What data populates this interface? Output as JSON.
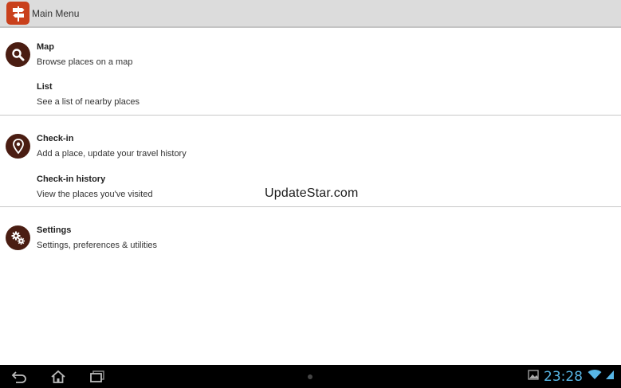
{
  "action_bar": {
    "title": "Main Menu",
    "app_icon": "signpost-icon"
  },
  "menu": [
    {
      "icon": "search-icon",
      "title": "Map",
      "subtitle": "Browse places on a map"
    },
    {
      "icon": null,
      "title": "List",
      "subtitle": "See a list of nearby places"
    },
    {
      "icon": "map-pin-icon",
      "title": "Check-in",
      "subtitle": "Add a place, update your travel history"
    },
    {
      "icon": null,
      "title": "Check-in history",
      "subtitle": "View the places you've visited"
    },
    {
      "icon": "gears-icon",
      "title": "Settings",
      "subtitle": "Settings, preferences & utilities"
    }
  ],
  "watermark": "UpdateStar.com",
  "system_bar": {
    "clock": "23:28",
    "buttons": [
      "back-icon",
      "home-icon",
      "recent-apps-icon"
    ],
    "status_icons": [
      "gallery-icon",
      "wifi-icon",
      "signal-icon"
    ],
    "clock_color": "#58b7e6"
  },
  "colors": {
    "app_icon_bg": "#c9401c",
    "menu_icon_bg": "#4a1d12",
    "action_bar_bg": "#dcdcdc"
  }
}
